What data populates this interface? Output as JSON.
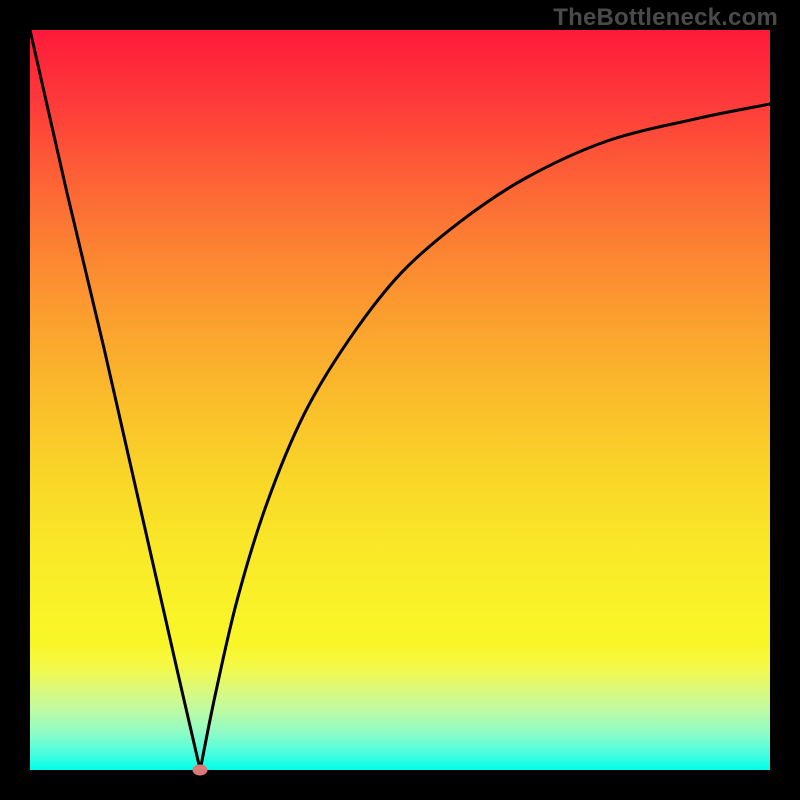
{
  "watermark": "TheBottleneck.com",
  "chart_data": {
    "type": "line",
    "title": "",
    "xlabel": "",
    "ylabel": "",
    "xlim": [
      0,
      100
    ],
    "ylim": [
      0,
      100
    ],
    "grid": false,
    "legend": false,
    "series": [
      {
        "name": "left-branch",
        "x": [
          0,
          5,
          10,
          15,
          20,
          23
        ],
        "values": [
          100,
          78,
          57,
          35,
          13,
          0
        ]
      },
      {
        "name": "right-branch",
        "x": [
          23,
          25,
          28,
          32,
          37,
          43,
          50,
          58,
          67,
          78,
          90,
          100
        ],
        "values": [
          0,
          10,
          23,
          36,
          48,
          58,
          67,
          74,
          80,
          85,
          88,
          90
        ]
      }
    ],
    "marker": {
      "x": 23,
      "y": 0,
      "color": "#d97a78"
    },
    "background_gradient": {
      "top": "#fe1a3a",
      "mid": "#fabd2b",
      "bottom": "#00fee6"
    }
  }
}
